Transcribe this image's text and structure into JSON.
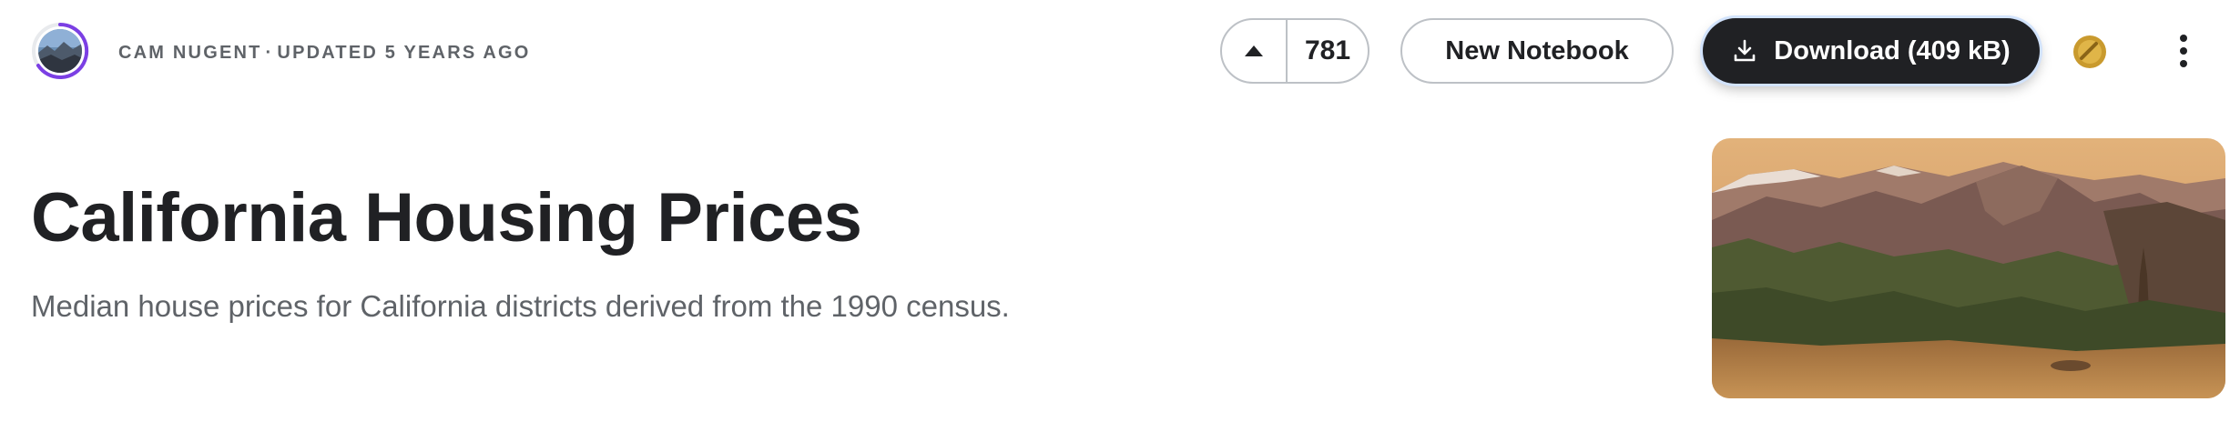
{
  "header": {
    "author": "Cam Nugent",
    "separator": "·",
    "updated": "Updated 5 years ago",
    "upvote_count": "781",
    "new_notebook_label": "New Notebook",
    "download_label": "Download (409 kB)"
  },
  "dataset": {
    "title": "California Housing Prices",
    "subtitle": "Median house prices for California districts derived from the 1990 census."
  },
  "icons": {
    "upvote": "caret-up-icon",
    "download": "download-icon",
    "medal": "medal-icon",
    "more": "more-vertical-icon"
  },
  "colors": {
    "primary_button": "#202124",
    "outline_border": "#bdc1c6",
    "avatar_ring": "#7b3fe4",
    "medal": "#c99a2e",
    "muted_text": "#5f6368"
  }
}
